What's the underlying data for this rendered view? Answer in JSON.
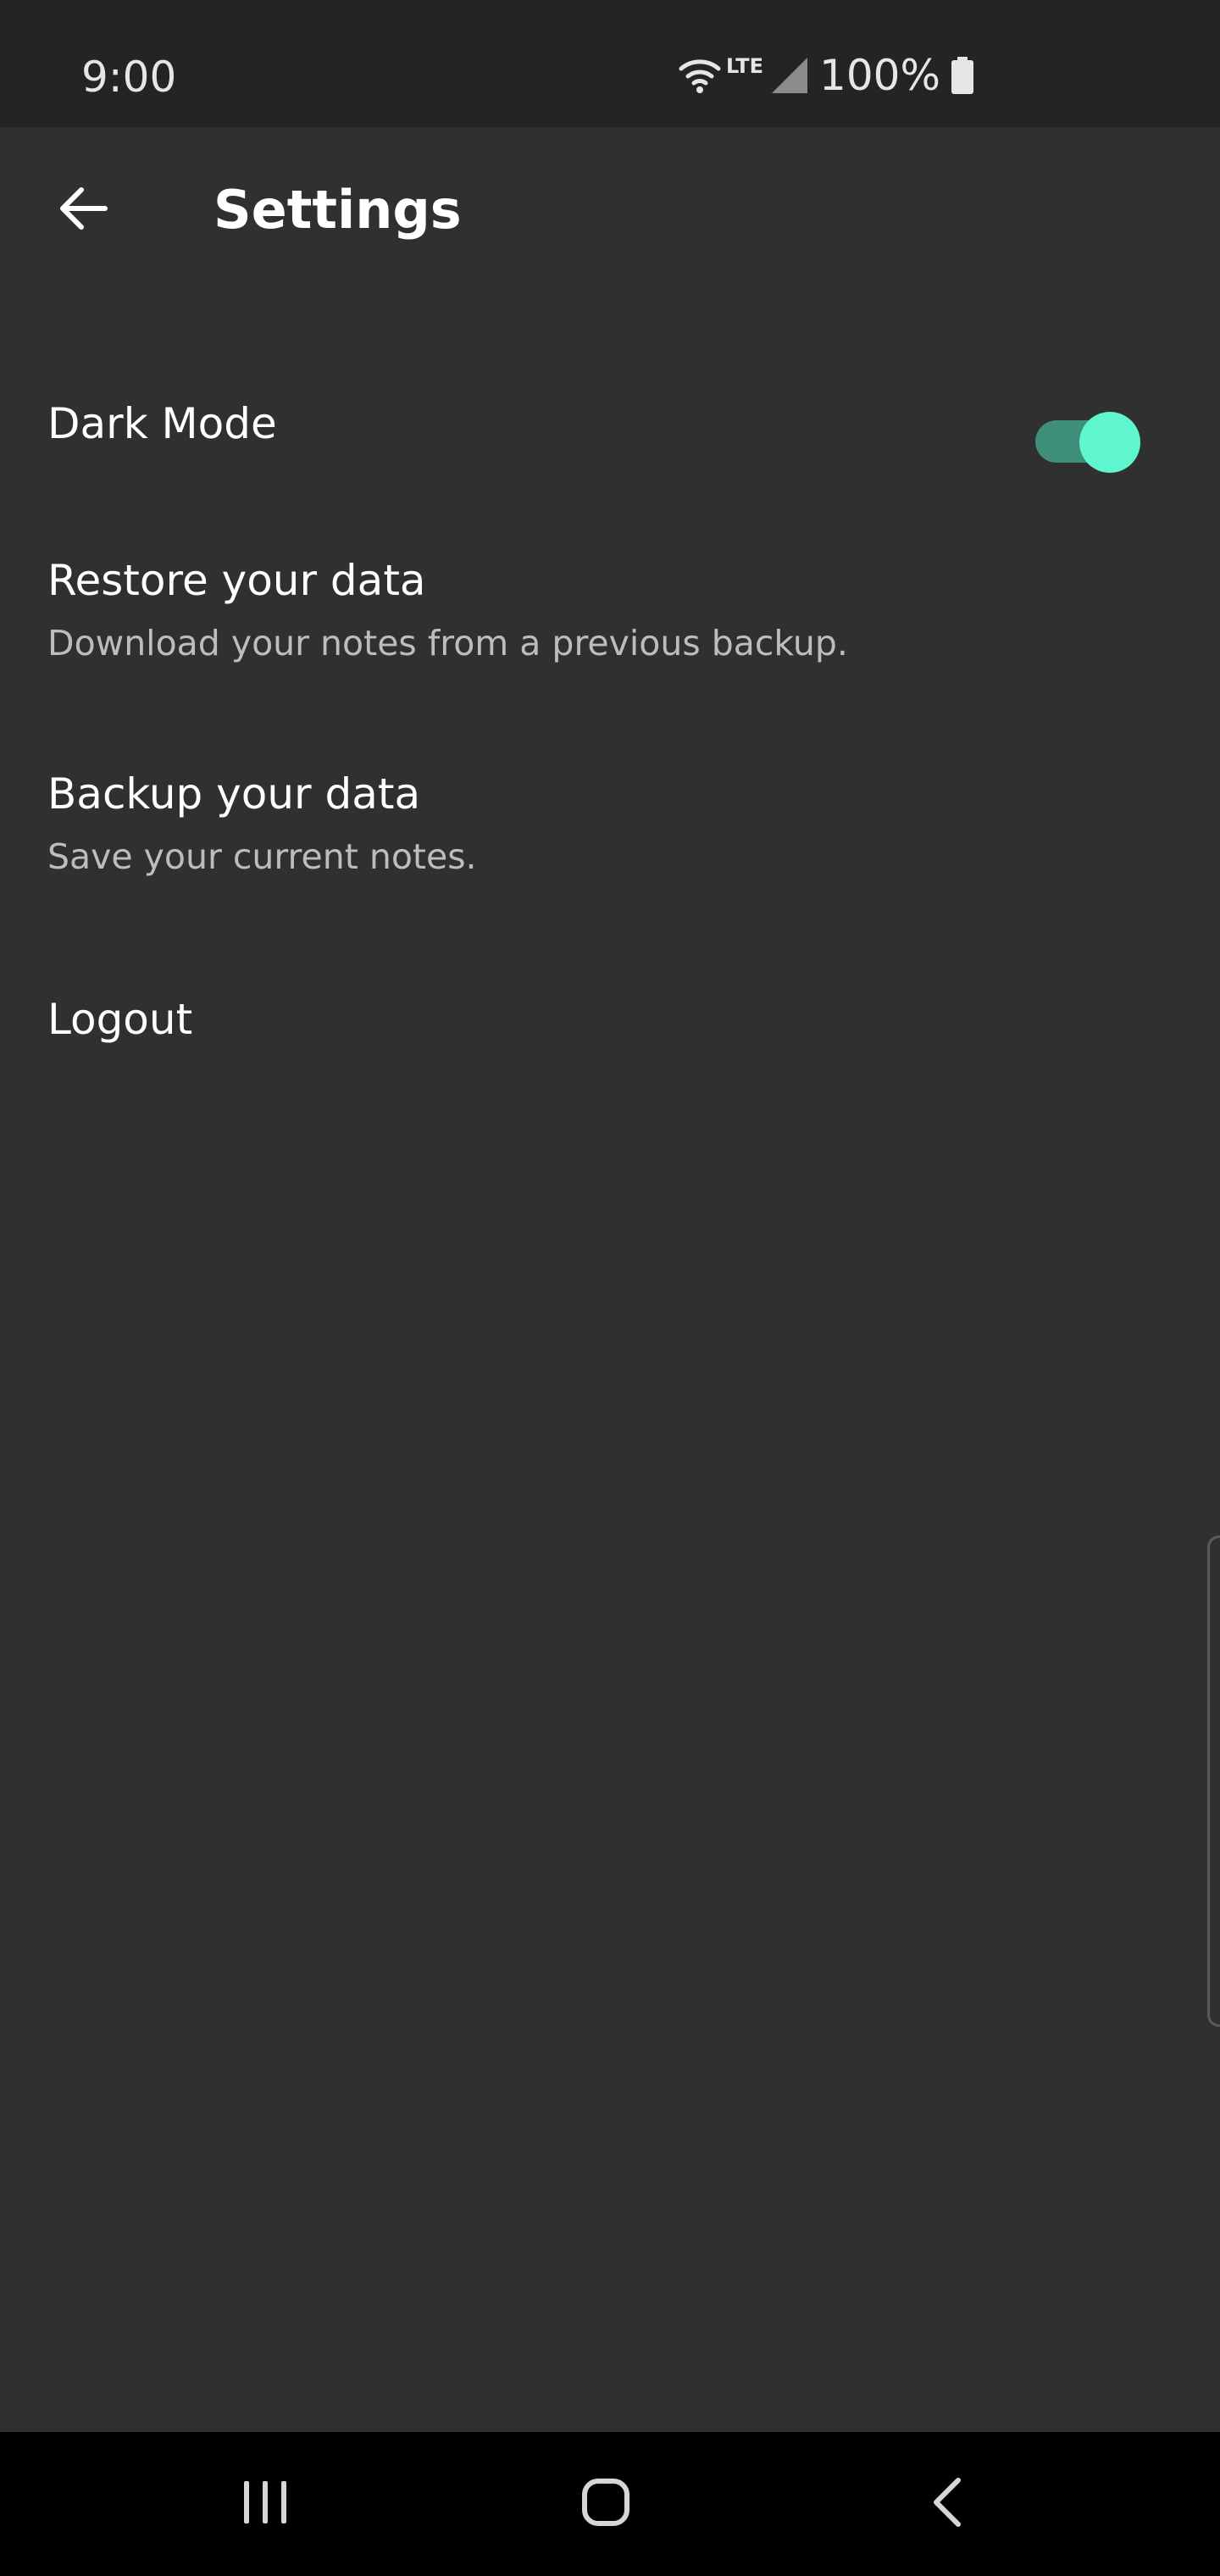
{
  "status_bar": {
    "time": "9:00",
    "network_label": "LTE",
    "battery_percent": "100%",
    "icons": [
      "wifi-icon",
      "signal-icon",
      "battery-icon"
    ]
  },
  "app_bar": {
    "title": "Settings",
    "back_icon": "arrow-back-icon"
  },
  "settings": {
    "dark_mode": {
      "label": "Dark Mode",
      "enabled": true
    },
    "restore": {
      "title": "Restore your data",
      "subtitle": "Download your notes from a previous backup."
    },
    "backup": {
      "title": "Backup your data",
      "subtitle": "Save your current notes."
    },
    "logout": {
      "title": "Logout"
    }
  },
  "nav_bar": {
    "icons": [
      "recent-apps-icon",
      "home-icon",
      "back-icon"
    ]
  },
  "colors": {
    "background": "#303030",
    "status_bar": "#242424",
    "toggle_track": "#3d8f7a",
    "toggle_thumb": "#5ff5cf",
    "nav_bar": "#000000"
  }
}
